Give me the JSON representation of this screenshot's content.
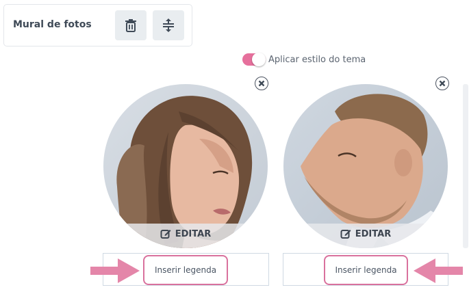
{
  "toolbar": {
    "title": "Mural de fotos",
    "trash_icon": "trash-icon",
    "spacing_icon": "vertical-spacing-icon"
  },
  "theme_toggle": {
    "label": "Aplicar estilo do tema",
    "on": true,
    "color": "#e6709c"
  },
  "photos": [
    {
      "edit_label": "EDITAR",
      "caption_placeholder": "Inserir legenda",
      "caption_value": ""
    },
    {
      "edit_label": "EDITAR",
      "caption_placeholder": "Inserir legenda",
      "caption_value": ""
    }
  ],
  "highlight_color": "#d9719d",
  "annotation_arrow_color": "#e486a9"
}
